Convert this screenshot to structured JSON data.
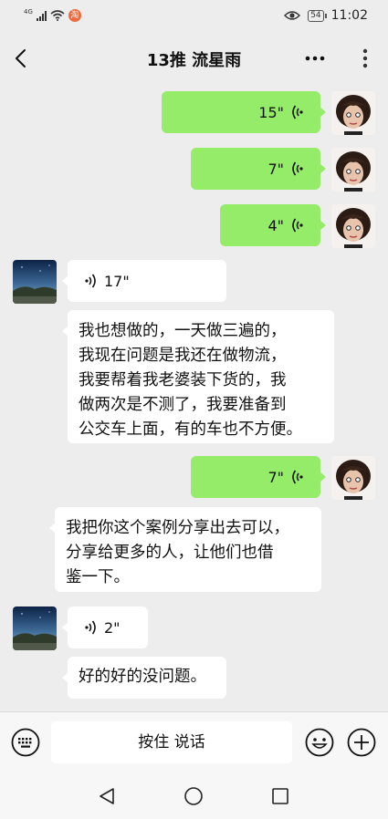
{
  "status_bar": {
    "network": "4G",
    "notification_badge": "淘",
    "battery": "54",
    "time": "11:02"
  },
  "header": {
    "title": "13推  流星雨"
  },
  "messages": [
    {
      "sender": "me",
      "type": "voice",
      "duration": "15\""
    },
    {
      "sender": "me",
      "type": "voice",
      "duration": "7\""
    },
    {
      "sender": "me",
      "type": "voice",
      "duration": "4\""
    },
    {
      "sender": "them",
      "type": "voice",
      "duration": "17\""
    },
    {
      "sender": "them",
      "type": "text",
      "lines": [
        "我也想做的，一天做三遍的，",
        "我现在问题是我还在做物流，",
        "我要帮着我老婆装下货的，我",
        "做两次是不测了，我要准备到",
        "公交车上面，有的车也不方便。"
      ]
    },
    {
      "sender": "me",
      "type": "voice",
      "duration": "7\""
    },
    {
      "sender": "them",
      "type": "text",
      "lines": [
        "我把你这个案例分享出去可以，",
        "分享给更多的人，让他们也借",
        "鉴一下。"
      ]
    },
    {
      "sender": "them",
      "type": "voice",
      "duration": "2\""
    },
    {
      "sender": "them",
      "type": "text",
      "lines": [
        "好的好的没问题。"
      ]
    }
  ],
  "input_bar": {
    "hold_to_talk_label": "按住 说话"
  },
  "colors": {
    "background": "#ededed",
    "my_bubble": "#95ec69",
    "their_bubble": "#ffffff"
  },
  "icons": [
    "back-icon",
    "more-icon",
    "menu-icon",
    "voice-wave-icon",
    "keyboard-icon",
    "emoji-icon",
    "plus-icon",
    "nav-back-icon",
    "nav-home-icon",
    "nav-recents-icon"
  ]
}
